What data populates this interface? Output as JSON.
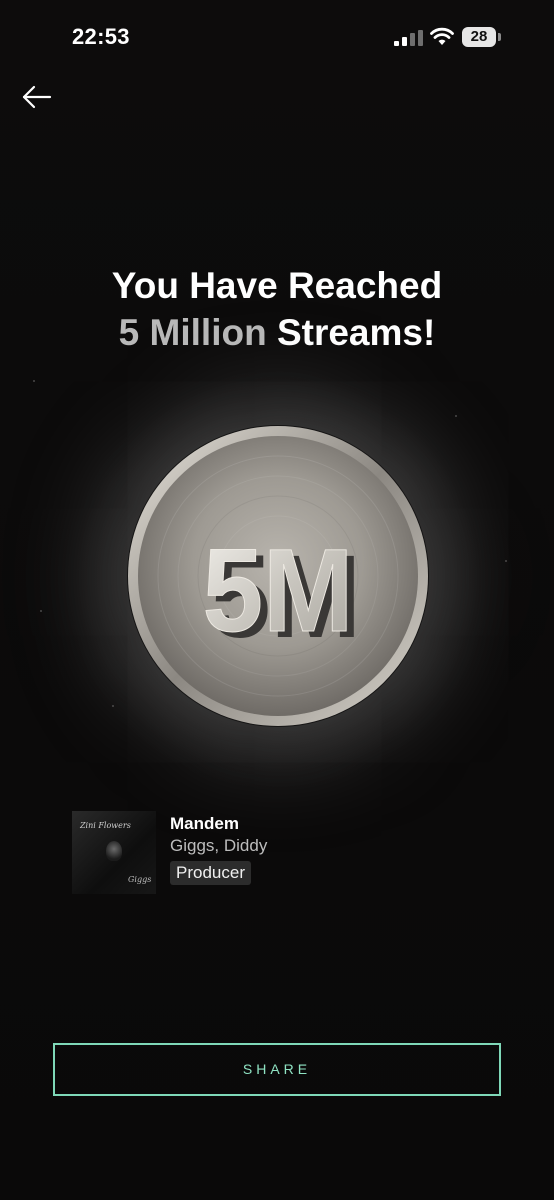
{
  "status_bar": {
    "time": "22:53",
    "battery_level": "28"
  },
  "nav": {
    "back_icon": "arrow-left-icon"
  },
  "headline": {
    "line1": "You Have Reached",
    "highlight": "5 Million",
    "line2_rest": "Streams!"
  },
  "medal": {
    "label": "5M"
  },
  "track": {
    "title": "Mandem",
    "artists": "Giggs, Diddy",
    "role": "Producer",
    "artwork_script_top": "Zini Flowers",
    "artwork_script_bottom": "Giggs"
  },
  "actions": {
    "share_label": "SHARE"
  },
  "colors": {
    "accent": "#7fd8b8",
    "background": "#0b0a0a"
  }
}
